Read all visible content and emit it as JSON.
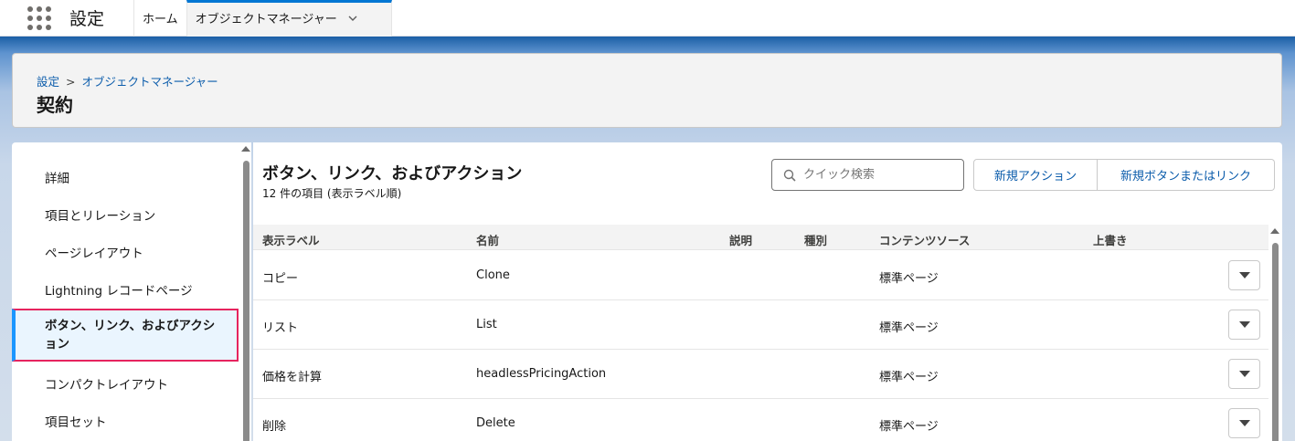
{
  "app": {
    "title": "設定"
  },
  "nav": {
    "tabs": [
      {
        "label": "ホーム"
      },
      {
        "label": "オブジェクトマネージャー"
      }
    ]
  },
  "header": {
    "breadcrumb": [
      "設定",
      "オブジェクトマネージャー"
    ],
    "breadcrumb_separator": ">",
    "title": "契約"
  },
  "sidebar": {
    "items": [
      {
        "label": "詳細"
      },
      {
        "label": "項目とリレーション"
      },
      {
        "label": "ページレイアウト"
      },
      {
        "label": "Lightning レコードページ"
      },
      {
        "label": "ボタン、リンク、およびアクション",
        "selected": true
      },
      {
        "label": "コンパクトレイアウト"
      },
      {
        "label": "項目セット"
      }
    ]
  },
  "main": {
    "title": "ボタン、リンク、およびアクション",
    "subtitle": "12 件の項目 (表示ラベル順)",
    "search": {
      "placeholder": "クイック検索",
      "value": ""
    },
    "buttons": {
      "new_action": "新規アクション",
      "new_button_or_link": "新規ボタンまたはリンク"
    },
    "table": {
      "columns": [
        "表示ラベル",
        "名前",
        "説明",
        "種別",
        "コンテンツソース",
        "上書き"
      ],
      "rows": [
        {
          "label": "コピー",
          "name": "Clone",
          "description": "",
          "type": "",
          "content_source": "標準ページ",
          "override": ""
        },
        {
          "label": "リスト",
          "name": "List",
          "description": "",
          "type": "",
          "content_source": "標準ページ",
          "override": ""
        },
        {
          "label": "価格を計算",
          "name": "headlessPricingAction",
          "description": "",
          "type": "",
          "content_source": "標準ページ",
          "override": ""
        },
        {
          "label": "削除",
          "name": "Delete",
          "description": "",
          "type": "",
          "content_source": "標準ページ",
          "override": ""
        }
      ]
    }
  },
  "colors": {
    "brand_blue": "#0176d3",
    "link_blue": "#0b5cab",
    "selection_highlight": "#e6245e",
    "selected_bg": "#eaf5fe"
  },
  "icons": {
    "app_launcher": "waffle-icon",
    "tab_dropdown": "chevron-down-icon",
    "search": "search-icon",
    "row_menu": "triangle-down-icon"
  }
}
